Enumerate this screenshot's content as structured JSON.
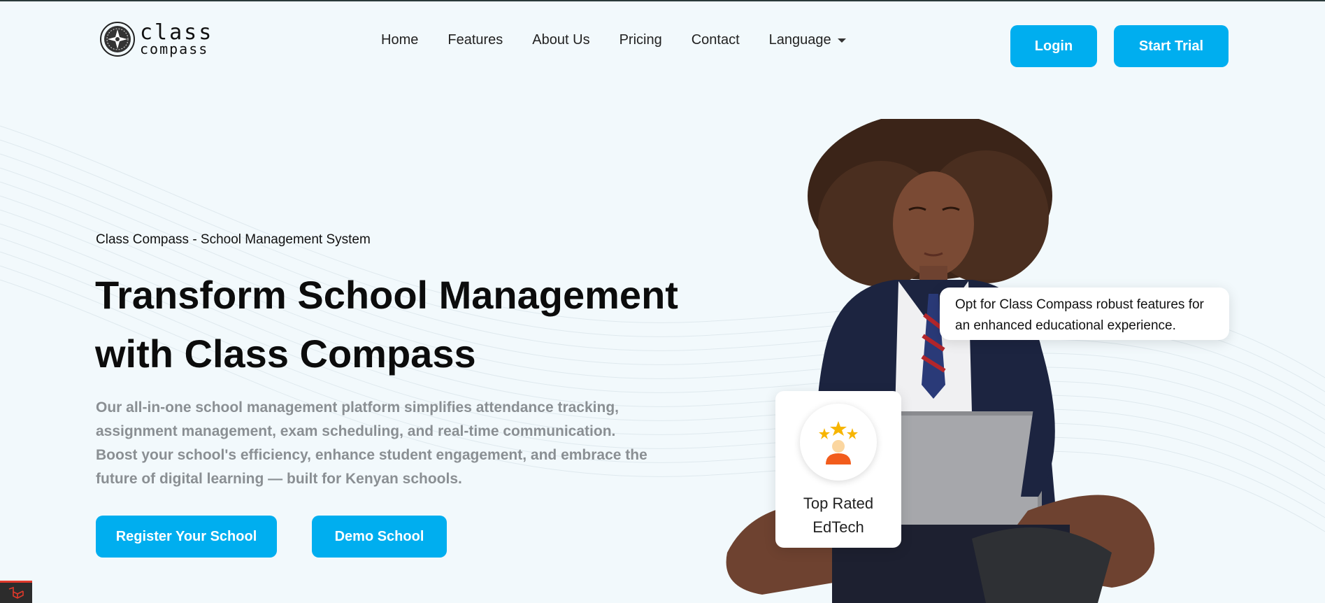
{
  "brand": {
    "logo_line1": "class",
    "logo_line2": "compass"
  },
  "nav": {
    "items": [
      "Home",
      "Features",
      "About Us",
      "Pricing",
      "Contact"
    ],
    "language_label": "Language"
  },
  "header_buttons": {
    "login": "Login",
    "start_trial": "Start Trial"
  },
  "hero": {
    "kicker": "Class Compass - School Management System",
    "headline_line1": "Transform School Management",
    "headline_line2": "with Class Compass",
    "description": "Our all-in-one school management platform simplifies attendance tracking, assignment management, exam scheduling, and real-time communication. Boost your school's efficiency, enhance student engagement, and embrace the future of digital learning — built for Kenyan schools.",
    "register_button": "Register Your School",
    "demo_button": "Demo School"
  },
  "callouts": {
    "bubble_text": "Opt for Class Compass robust features for an enhanced educational experience.",
    "badge_line1": "Top Rated",
    "badge_line2": "EdTech"
  },
  "colors": {
    "accent": "#00aeef",
    "background": "#f2f9fc",
    "muted_text": "#8a8f93"
  },
  "icons": [
    "compass-logo-icon",
    "chevron-down-icon",
    "star-rating-icon",
    "laravel-icon"
  ]
}
